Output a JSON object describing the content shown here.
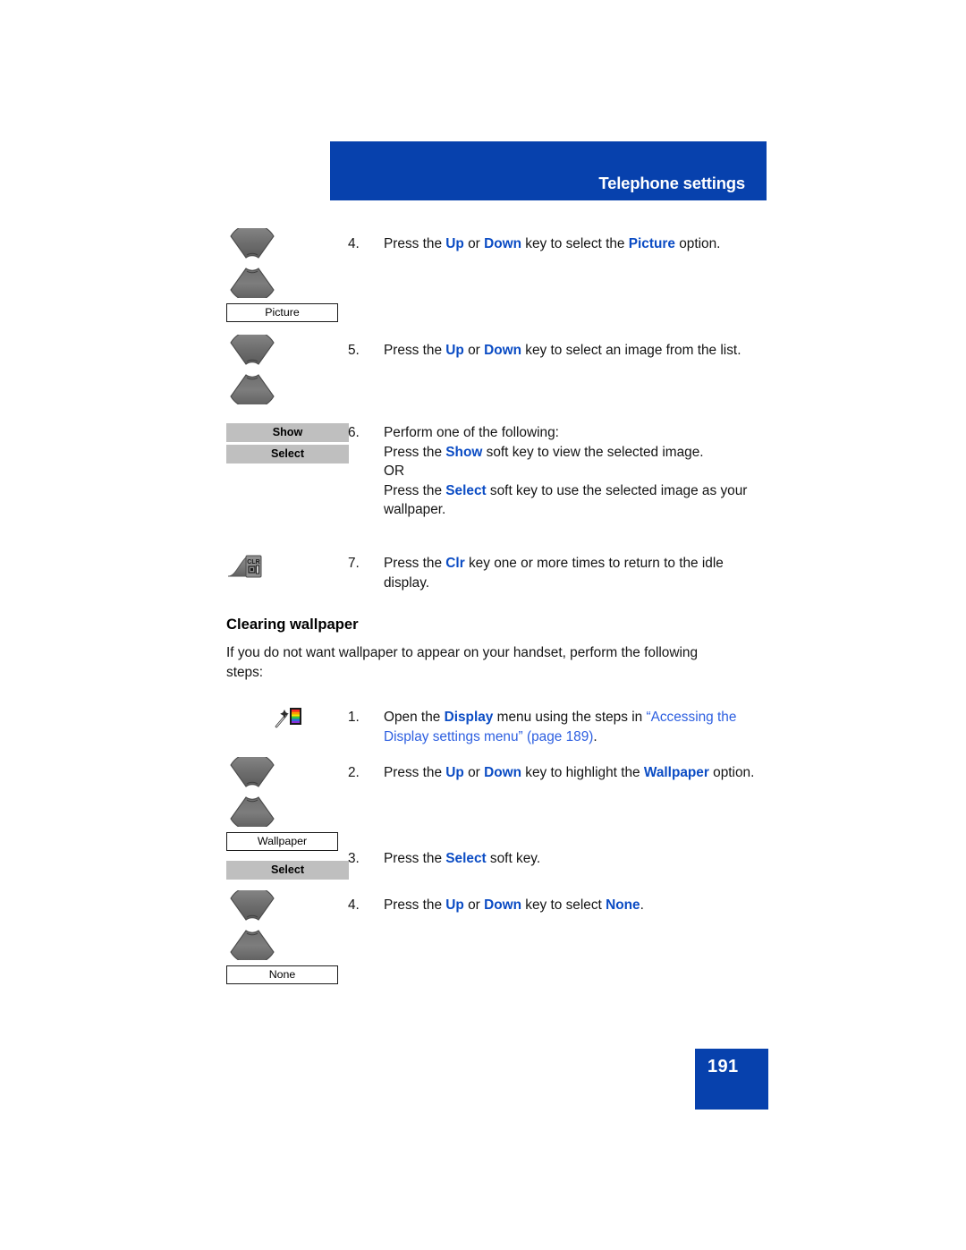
{
  "header": {
    "title": "Telephone settings",
    "banner_color": "#0741AD"
  },
  "colors": {
    "brand_blue": "#0741AD",
    "keyword_blue": "#0B4CC4",
    "xref_blue": "#2D5FE0",
    "softkey_gray": "#BFBFBF"
  },
  "steps_wallpaper_set": [
    {
      "number": "4.",
      "icon": "navigation-up-down-key",
      "label_box": "Picture",
      "text_parts": [
        {
          "t": "Press the ",
          "s": "plain"
        },
        {
          "t": "Up",
          "s": "kw"
        },
        {
          "t": " or ",
          "s": "plain"
        },
        {
          "t": "Down",
          "s": "kw"
        },
        {
          "t": " key to select the ",
          "s": "plain"
        },
        {
          "t": "Picture",
          "s": "kw"
        },
        {
          "t": " option.",
          "s": "plain"
        }
      ]
    },
    {
      "number": "5.",
      "icon": "navigation-up-down-key",
      "label_box": null,
      "text_parts": [
        {
          "t": "Press the ",
          "s": "plain"
        },
        {
          "t": "Up",
          "s": "kw"
        },
        {
          "t": " or ",
          "s": "plain"
        },
        {
          "t": "Down",
          "s": "kw"
        },
        {
          "t": " key to select an image from the list.",
          "s": "plain"
        }
      ]
    },
    {
      "number": "6.",
      "icon": "soft-keys",
      "softkeys": [
        "Show",
        "Select"
      ],
      "text_parts": [
        {
          "t": "Perform one of the following:",
          "s": "plain"
        },
        {
          "t": "\n",
          "s": "br"
        },
        {
          "t": "Press the ",
          "s": "plain"
        },
        {
          "t": "Show",
          "s": "kw"
        },
        {
          "t": " soft key to view the selected image.",
          "s": "plain"
        },
        {
          "t": "\n",
          "s": "br"
        },
        {
          "t": "OR",
          "s": "plain"
        },
        {
          "t": "\n",
          "s": "br"
        },
        {
          "t": "Press the ",
          "s": "plain"
        },
        {
          "t": "Select",
          "s": "kw"
        },
        {
          "t": " soft key to use the selected image as your wallpaper.",
          "s": "plain"
        }
      ]
    },
    {
      "number": "7.",
      "icon": "clr-key",
      "text_parts": [
        {
          "t": "Press the ",
          "s": "plain"
        },
        {
          "t": "Clr",
          "s": "kw"
        },
        {
          "t": " key one or more times to return to the idle display.",
          "s": "plain"
        }
      ]
    }
  ],
  "section": {
    "heading": "Clearing wallpaper",
    "intro": "If you do not want wallpaper to appear on your handset, perform the following steps:"
  },
  "steps_clearing": [
    {
      "number": "1.",
      "icon": "display-settings-icon",
      "text_parts": [
        {
          "t": "Open the ",
          "s": "plain"
        },
        {
          "t": "Display",
          "s": "kw"
        },
        {
          "t": " menu using the steps in ",
          "s": "plain"
        },
        {
          "t": "“Accessing the Display settings menu” (page 189)",
          "s": "xref"
        },
        {
          "t": ".",
          "s": "plain"
        }
      ]
    },
    {
      "number": "2.",
      "icon": "navigation-up-down-key",
      "label_box": "Wallpaper",
      "text_parts": [
        {
          "t": "Press the ",
          "s": "plain"
        },
        {
          "t": "Up",
          "s": "kw"
        },
        {
          "t": " or ",
          "s": "plain"
        },
        {
          "t": "Down",
          "s": "kw"
        },
        {
          "t": " key to highlight the ",
          "s": "plain"
        },
        {
          "t": "Wallpaper",
          "s": "kw"
        },
        {
          "t": " option.",
          "s": "plain"
        }
      ]
    },
    {
      "number": "3.",
      "icon": "soft-key-select",
      "softkeys": [
        "Select"
      ],
      "text_parts": [
        {
          "t": "Press the ",
          "s": "plain"
        },
        {
          "t": "Select",
          "s": "kw"
        },
        {
          "t": " soft key.",
          "s": "plain"
        }
      ]
    },
    {
      "number": "4.",
      "icon": "navigation-up-down-key",
      "label_box": "None",
      "text_parts": [
        {
          "t": "Press the ",
          "s": "plain"
        },
        {
          "t": "Up",
          "s": "kw"
        },
        {
          "t": " or ",
          "s": "plain"
        },
        {
          "t": "Down",
          "s": "kw"
        },
        {
          "t": " key to select ",
          "s": "plain"
        },
        {
          "t": "None",
          "s": "kw"
        },
        {
          "t": ".",
          "s": "plain"
        }
      ]
    }
  ],
  "labels": {
    "picture": "Picture",
    "wallpaper": "Wallpaper",
    "none": "None",
    "show": "Show",
    "select": "Select",
    "select2": "Select",
    "clr_key_text": "CLR"
  },
  "footer": {
    "page_number": "191"
  }
}
